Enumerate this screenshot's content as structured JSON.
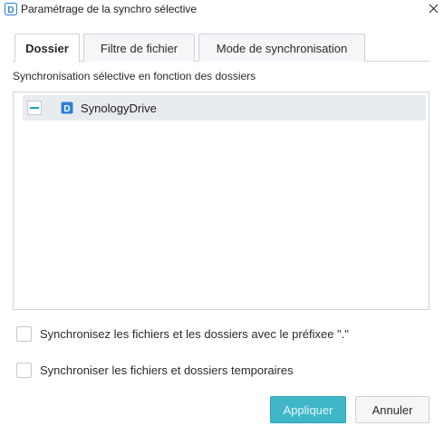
{
  "window": {
    "title": "Paramétrage de la synchro sélective",
    "app_icon": "synology-drive-icon",
    "close_icon": "close-icon"
  },
  "tabs": [
    {
      "label": "Dossier",
      "active": true
    },
    {
      "label": "Filtre de fichier",
      "active": false
    },
    {
      "label": "Mode de synchronisation",
      "active": false
    }
  ],
  "folder_panel": {
    "label": "Synchronisation sélective en fonction des dossiers",
    "tree": [
      {
        "label": "SynologyDrive",
        "state": "partial",
        "icon": "synology-drive-folder-icon"
      }
    ]
  },
  "options": [
    {
      "label": "Synchronisez les fichiers et les dossiers avec le préfixee \".\"",
      "checked": false
    },
    {
      "label": "Synchroniser les fichiers et dossiers temporaires",
      "checked": false
    }
  ],
  "buttons": {
    "apply": "Appliquer",
    "cancel": "Annuler"
  },
  "colors": {
    "accent": "#3fb7c8",
    "icon_blue": "#2f7fd6"
  }
}
